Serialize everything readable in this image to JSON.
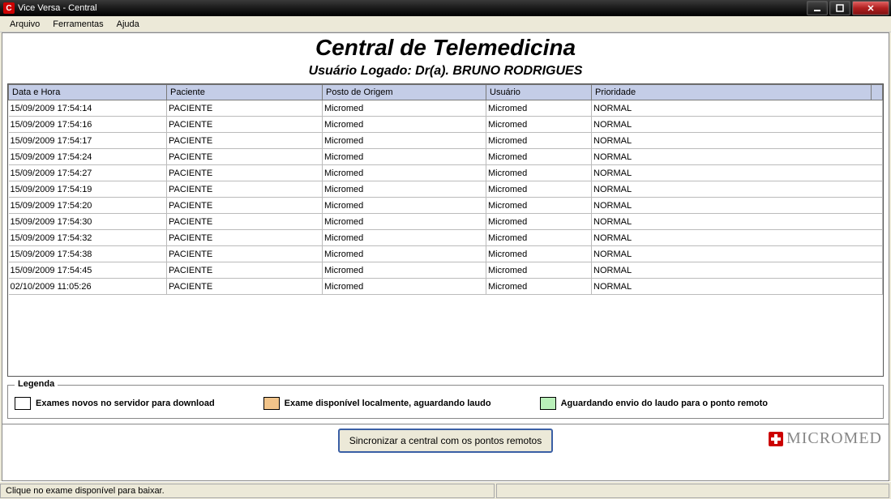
{
  "window": {
    "title": "Vice Versa - Central"
  },
  "menu": {
    "arquivo": "Arquivo",
    "ferramentas": "Ferramentas",
    "ajuda": "Ajuda"
  },
  "header": {
    "page_title": "Central de Telemedicina",
    "user_prefix": "Usuário Logado: Dr(a). ",
    "user_name": "BRUNO RODRIGUES"
  },
  "columns": {
    "c0": "Data e Hora",
    "c1": "Paciente",
    "c2": "Posto de Origem",
    "c3": "Usuário",
    "c4": "Prioridade"
  },
  "rows": [
    {
      "c0": "15/09/2009 17:54:14",
      "c1": "PACIENTE",
      "c2": "Micromed",
      "c3": "Micromed",
      "c4": "NORMAL"
    },
    {
      "c0": "15/09/2009 17:54:16",
      "c1": "PACIENTE",
      "c2": "Micromed",
      "c3": "Micromed",
      "c4": "NORMAL"
    },
    {
      "c0": "15/09/2009 17:54:17",
      "c1": "PACIENTE",
      "c2": "Micromed",
      "c3": "Micromed",
      "c4": "NORMAL"
    },
    {
      "c0": "15/09/2009 17:54:24",
      "c1": "PACIENTE",
      "c2": "Micromed",
      "c3": "Micromed",
      "c4": "NORMAL"
    },
    {
      "c0": "15/09/2009 17:54:27",
      "c1": "PACIENTE",
      "c2": "Micromed",
      "c3": "Micromed",
      "c4": "NORMAL"
    },
    {
      "c0": "15/09/2009 17:54:19",
      "c1": "PACIENTE",
      "c2": "Micromed",
      "c3": "Micromed",
      "c4": "NORMAL"
    },
    {
      "c0": "15/09/2009 17:54:20",
      "c1": "PACIENTE",
      "c2": "Micromed",
      "c3": "Micromed",
      "c4": "NORMAL"
    },
    {
      "c0": "15/09/2009 17:54:30",
      "c1": "PACIENTE",
      "c2": "Micromed",
      "c3": "Micromed",
      "c4": "NORMAL"
    },
    {
      "c0": "15/09/2009 17:54:32",
      "c1": "PACIENTE",
      "c2": "Micromed",
      "c3": "Micromed",
      "c4": "NORMAL"
    },
    {
      "c0": "15/09/2009 17:54:38",
      "c1": "PACIENTE",
      "c2": "Micromed",
      "c3": "Micromed",
      "c4": "NORMAL"
    },
    {
      "c0": "15/09/2009 17:54:45",
      "c1": "PACIENTE",
      "c2": "Micromed",
      "c3": "Micromed",
      "c4": "NORMAL"
    },
    {
      "c0": "02/10/2009 11:05:26",
      "c1": "PACIENTE",
      "c2": "Micromed",
      "c3": "Micromed",
      "c4": "NORMAL"
    }
  ],
  "legend": {
    "title": "Legenda",
    "i0": {
      "color": "#ffffff",
      "label": "Exames novos no servidor para download"
    },
    "i1": {
      "color": "#f2c48a",
      "label": "Exame disponível localmente, aguardando laudo"
    },
    "i2": {
      "color": "#b9f0b9",
      "label": "Aguardando envio do laudo para o ponto remoto"
    }
  },
  "actions": {
    "sync": "Sincronizar a central com os pontos remotos"
  },
  "brand": {
    "name": "MICROMED"
  },
  "status": {
    "text": "Clique no exame disponível para baixar."
  }
}
